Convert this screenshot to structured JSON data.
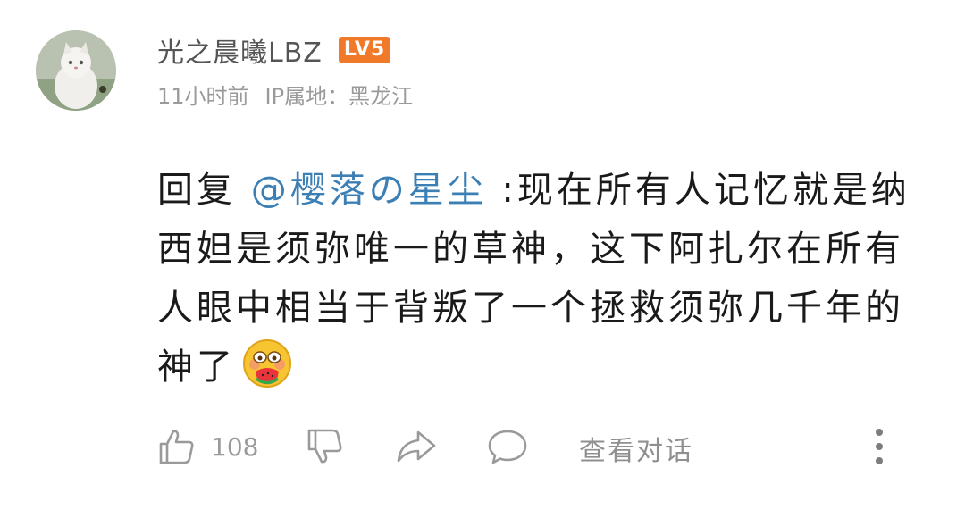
{
  "user": {
    "name": "光之晨曦LBZ",
    "level": "LV5"
  },
  "meta": {
    "time": "11小时前",
    "ip_location": "IP属地：黑龙江"
  },
  "comment": {
    "reply_prefix": "回复 ",
    "mention": "@樱落の星尘",
    "text": " :现在所有人记忆就是纳西妲是须弥唯一的草神，这下阿扎尔在所有人眼中相当于背叛了一个拯救须弥几千年的神了",
    "emoji": "eating-watermelon-emoji"
  },
  "actions": {
    "like_count": "108",
    "view_conversation": "查看对话"
  },
  "colors": {
    "mention": "#3b7fb5",
    "level_badge": "#f07a2a",
    "meta_text": "#9a9a9a"
  }
}
